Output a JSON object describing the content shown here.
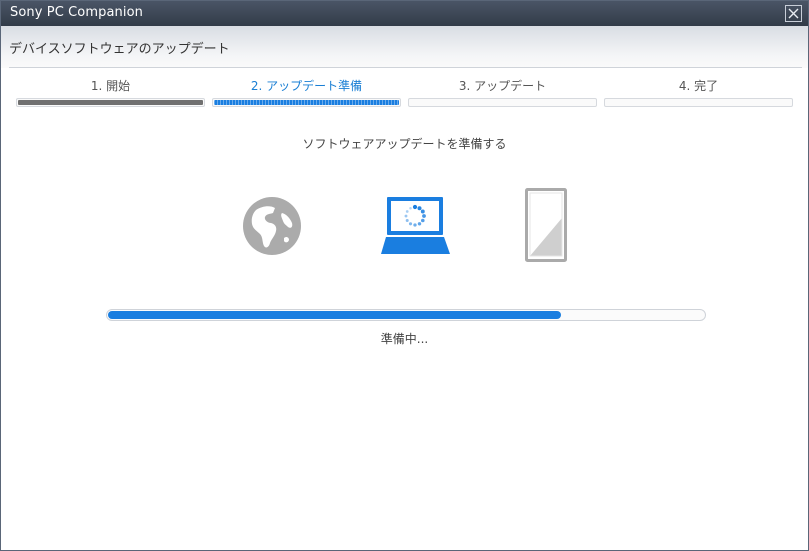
{
  "window": {
    "title": "Sony PC Companion"
  },
  "header": {
    "title": "デバイスソフトウェアのアップデート"
  },
  "steps": [
    {
      "label": "1. 開始",
      "state": "done",
      "progress": 1.0
    },
    {
      "label": "2. アップデート準備",
      "state": "active",
      "progress": 1.0
    },
    {
      "label": "3. アップデート",
      "state": "pending",
      "progress": 0
    },
    {
      "label": "4. 完了",
      "state": "pending",
      "progress": 0
    }
  ],
  "main": {
    "subtitle": "ソフトウェアアップデートを準備する",
    "icons": [
      "globe-icon",
      "laptop-icon",
      "tablet-icon"
    ],
    "progress_fraction": 0.76,
    "status": "準備中..."
  },
  "colors": {
    "accent": "#1a7ee0",
    "done": "#707070",
    "icon_gray": "#aaaaaa",
    "titlebar": "#3d4655"
  }
}
